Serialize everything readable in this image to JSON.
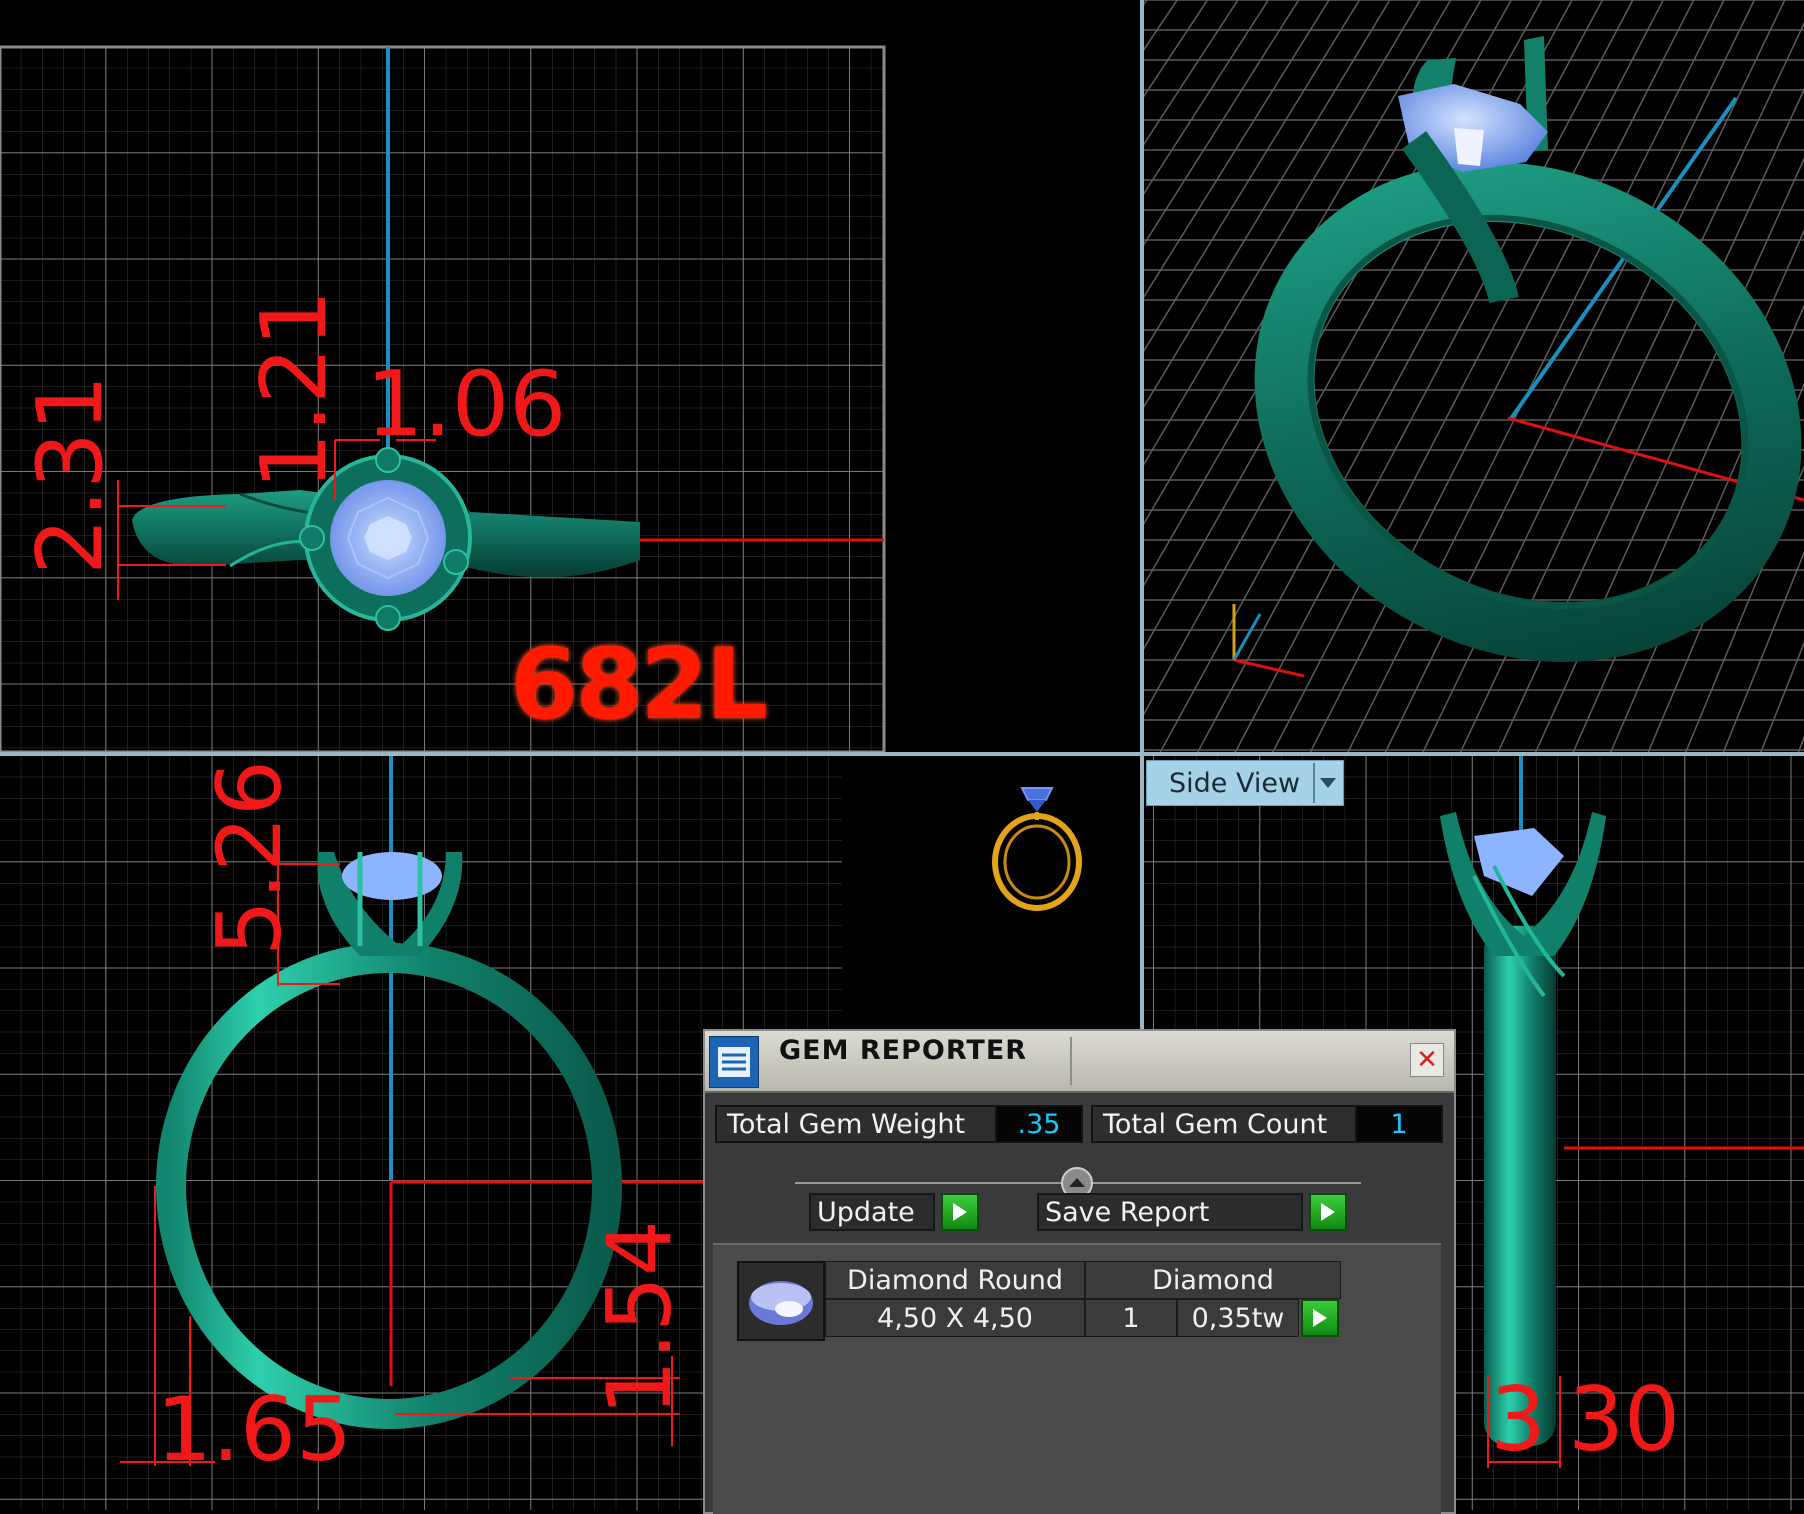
{
  "viewports": {
    "top_view": {
      "dimensions": [
        "2.31",
        "1.21",
        "1.06"
      ],
      "model_id": "682L"
    },
    "bottom_left": {
      "dimensions": [
        "5.26",
        "1.54",
        "1.65"
      ]
    },
    "side_view": {
      "view_selector": "Side View",
      "dimensions": [
        "3",
        "30"
      ]
    }
  },
  "gem_reporter": {
    "title": "GEM REPORTER",
    "total_weight_label": "Total Gem Weight",
    "total_weight_value": ".35",
    "total_count_label": "Total Gem Count",
    "total_count_value": "1",
    "update_label": "Update",
    "save_report_label": "Save Report",
    "gems": [
      {
        "cut": "Diamond Round",
        "type": "Diamond",
        "size": "4,50 X 4,50",
        "count": "1",
        "weight": "0,35tw"
      }
    ]
  },
  "colors": {
    "metal": "#0f7a66",
    "gem": "#8cb4ff",
    "dimension": "#f01818",
    "axis_blue": "#1a8fc0",
    "axis_red": "#e01010",
    "grid": "#6a6a6a",
    "accent_value": "#16c8ff"
  },
  "icons": [
    "gem-reporter-icon",
    "close-icon",
    "play-arrow-icon",
    "dropdown-arrow-icon",
    "ring-navigator-icon",
    "gem-thumbnail-icon"
  ]
}
